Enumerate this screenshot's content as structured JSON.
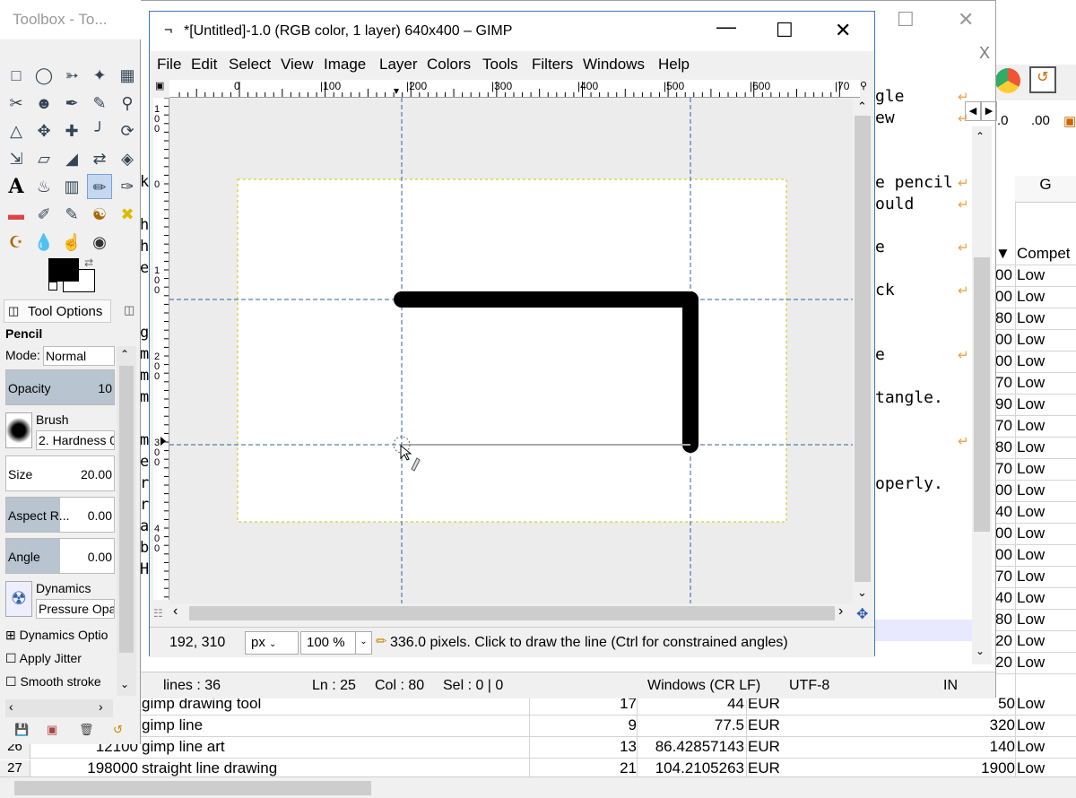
{
  "spreadsheet": {
    "rows": [
      {
        "num": "",
        "a": "",
        "b": "gimp drawing tool",
        "c": "17",
        "d": "44",
        "e": "EUR",
        "f": "50",
        "g": "Low"
      },
      {
        "num": "",
        "a": "",
        "b": "gimp line",
        "c": "9",
        "d": "77.5",
        "e": "EUR",
        "f": "320",
        "g": "Low"
      },
      {
        "num": "26",
        "a": "12100",
        "b": "gimp line art",
        "c": "13",
        "d": "86.42857143",
        "e": "EUR",
        "f": "140",
        "g": "Low"
      },
      {
        "num": "27",
        "a": "198000",
        "b": "straight line drawing",
        "c": "21",
        "d": "104.2105263",
        "e": "EUR",
        "f": "1900",
        "g": "Low"
      }
    ],
    "right_column": {
      "header": "G",
      "subheader": "Compet",
      "cells": [
        {
          "n": "00",
          "t": "Low"
        },
        {
          "n": "00",
          "t": "Low"
        },
        {
          "n": "80",
          "t": "Low"
        },
        {
          "n": "00",
          "t": "Low"
        },
        {
          "n": "00",
          "t": "Low"
        },
        {
          "n": "70",
          "t": "Low"
        },
        {
          "n": "90",
          "t": "Low"
        },
        {
          "n": "70",
          "t": "Low"
        },
        {
          "n": "80",
          "t": "Low"
        },
        {
          "n": "70",
          "t": "Low"
        },
        {
          "n": "00",
          "t": "Low"
        },
        {
          "n": "40",
          "t": "Low"
        },
        {
          "n": "00",
          "t": "Low"
        },
        {
          "n": "00",
          "t": "Low"
        },
        {
          "n": "70",
          "t": "Low"
        },
        {
          "n": "40",
          "t": "Low"
        },
        {
          "n": "80",
          "t": "Low"
        },
        {
          "n": "20",
          "t": "Low"
        },
        {
          "n": "20",
          "t": "Low"
        }
      ]
    }
  },
  "editor": {
    "close_label": "X",
    "lines": [
      {
        "text": "gle",
        "wrap": true
      },
      {
        "text": "ew",
        "wrap": true
      },
      {
        "text": "",
        "wrap": false
      },
      {
        "text": "",
        "wrap": false
      },
      {
        "text": "e pencil",
        "wrap": true
      },
      {
        "text": "ould",
        "wrap": true
      },
      {
        "text": "",
        "wrap": false
      },
      {
        "text": "e",
        "wrap": true
      },
      {
        "text": "",
        "wrap": false
      },
      {
        "text": "ck",
        "wrap": true
      },
      {
        "text": "",
        "wrap": false
      },
      {
        "text": "",
        "wrap": false
      },
      {
        "text": "e",
        "wrap": true
      },
      {
        "text": "",
        "wrap": false
      },
      {
        "text": "tangle.",
        "wrap": false
      },
      {
        "text": "",
        "wrap": false
      },
      {
        "text": "",
        "wrap": true
      },
      {
        "text": "",
        "wrap": false
      },
      {
        "text": "operly.",
        "wrap": false
      }
    ],
    "left_letters": [
      "k",
      "",
      "h",
      "h",
      "e",
      "",
      "",
      "g",
      "m",
      "m",
      "m",
      "",
      "m",
      "e",
      "r",
      "r",
      "a",
      "b",
      "H"
    ],
    "status": {
      "lines": "lines : 36",
      "ln": "Ln : 25",
      "col": "Col : 80",
      "sel": "Sel : 0 | 0",
      "eol": "Windows (CR LF)",
      "enc": "UTF-8",
      "mode": "IN"
    }
  },
  "toolbox": {
    "title": "Toolbox - To...",
    "tool_options_tab": "Tool Options",
    "tool_name": "Pencil",
    "mode_label": "Mode:",
    "mode_value": "Normal",
    "opacity_label": "Opacity",
    "opacity_value": "10",
    "brush_label": "Brush",
    "brush_value": "2. Hardness 0",
    "size_label": "Size",
    "size_value": "20.00",
    "aspect_label": "Aspect R...",
    "aspect_value": "0.00",
    "angle_label": "Angle",
    "angle_value": "0.00",
    "dynamics_label": "Dynamics",
    "dynamics_value": "Pressure Opa",
    "dynamics_options": "Dynamics Optio",
    "apply_jitter": "Apply Jitter",
    "smooth_stroke": "Smooth stroke"
  },
  "gimp": {
    "title": "*[Untitled]-1.0 (RGB color, 1 layer) 640x400 – GIMP",
    "menu": [
      "File",
      "Edit",
      "Select",
      "View",
      "Image",
      "Layer",
      "Colors",
      "Tools",
      "Filters",
      "Windows",
      "Help"
    ],
    "ruler_top_labels": [
      "0",
      "|100",
      "|200",
      "|300",
      "|400",
      "|500",
      "|600",
      "|70"
    ],
    "ruler_left_labels": [
      "1\n0\n0",
      "0",
      "1\n0\n0",
      "2\n0\n0",
      "3\n0\n0",
      "4\n0\n0"
    ],
    "status": {
      "coords": "192, 310",
      "unit": "px",
      "zoom": "100 %",
      "message": "336.0 pixels.  Click to draw the line (Ctrl for constrained angles)"
    }
  }
}
